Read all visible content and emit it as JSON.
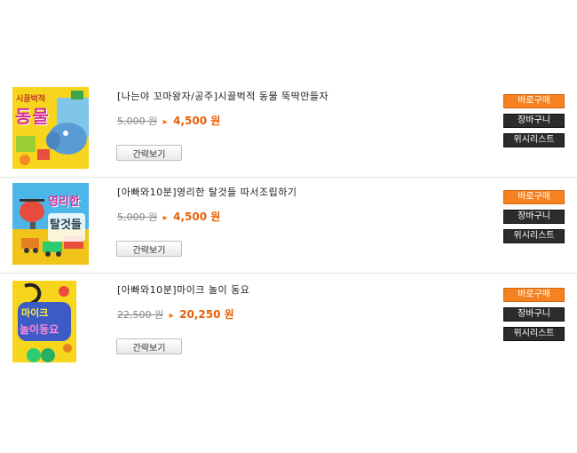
{
  "products": [
    {
      "title": "[나는야 꼬마왕자/공주]시끌벅적 동물 뚝딱만들자",
      "old_price": "5,000 원",
      "arrow": "▸",
      "new_price": "4,500 원",
      "thumb_text_top": "시끌벅적",
      "thumb_text_main": "동물",
      "quick_label": "간략보기",
      "buy_label": "바로구매",
      "cart_label": "장바구니",
      "wish_label": "위시리스트"
    },
    {
      "title": "[아빠와10분]영리한 탈것들 따서조립하기",
      "old_price": "5,000 원",
      "arrow": "▸",
      "new_price": "4,500 원",
      "thumb_text_top": "영리한",
      "thumb_text_main": "탈것들",
      "quick_label": "간략보기",
      "buy_label": "바로구매",
      "cart_label": "장바구니",
      "wish_label": "위시리스트"
    },
    {
      "title": "[아빠와10분]마이크 놀이 동요",
      "old_price": "22,500 원",
      "arrow": "▸",
      "new_price": "20,250 원",
      "thumb_text_top": "마이크",
      "thumb_text_main": "놀이동요",
      "quick_label": "간략보기",
      "buy_label": "바로구매",
      "cart_label": "장바구니",
      "wish_label": "위시리스트"
    }
  ],
  "colors": {
    "buy_button": "#f5821f",
    "dark_button": "#2c2c2c",
    "sale_price": "#e8600a"
  }
}
